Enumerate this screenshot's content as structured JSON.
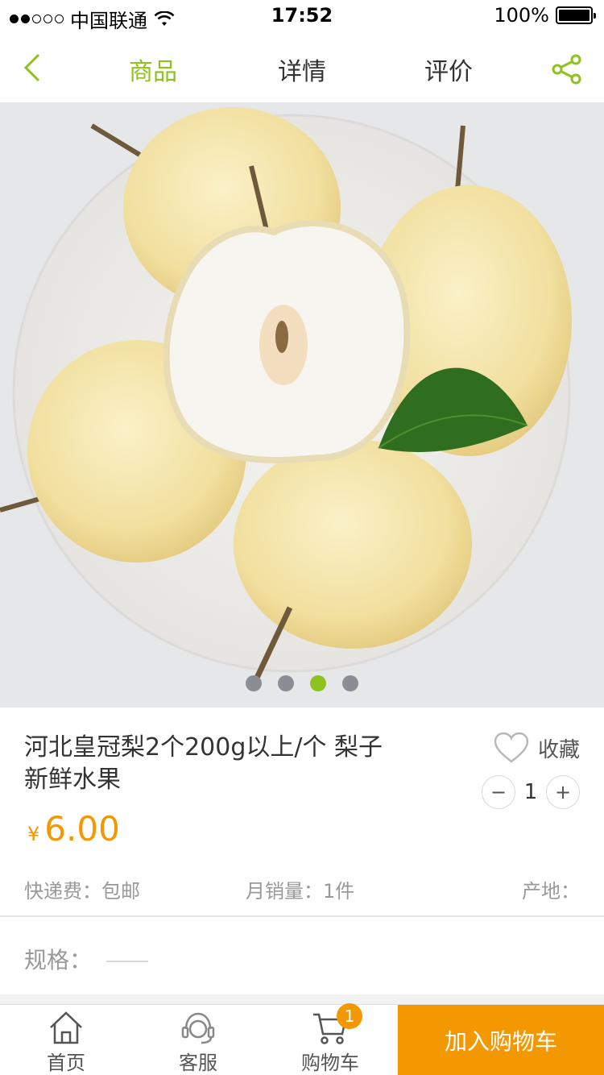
{
  "status_bar": {
    "carrier": "中国联通",
    "time": "17:52",
    "battery": "100%"
  },
  "nav": {
    "tabs": [
      {
        "label": "商品"
      },
      {
        "label": "详情"
      },
      {
        "label": "评价"
      }
    ],
    "active_tab": 0,
    "accent_color": "#8dc21f"
  },
  "carousel": {
    "total": 4,
    "active_index": 2
  },
  "product": {
    "title": "河北皇冠梨2个200g以上/个 梨子 新鲜水果",
    "currency_symbol": "¥",
    "price": "6.00",
    "favorite_label": "收藏",
    "quantity": "1",
    "decrement_label": "−",
    "increment_label": "+",
    "shipping": "快递费：包邮",
    "monthly_sales": "月销量：1件",
    "origin": "产地："
  },
  "spec": {
    "label": "规格："
  },
  "bottom_bar": {
    "home_label": "首页",
    "service_label": "客服",
    "cart_label": "购物车",
    "cart_count": "1",
    "add_to_cart": "加入购物车",
    "accent_color": "#f39800"
  }
}
